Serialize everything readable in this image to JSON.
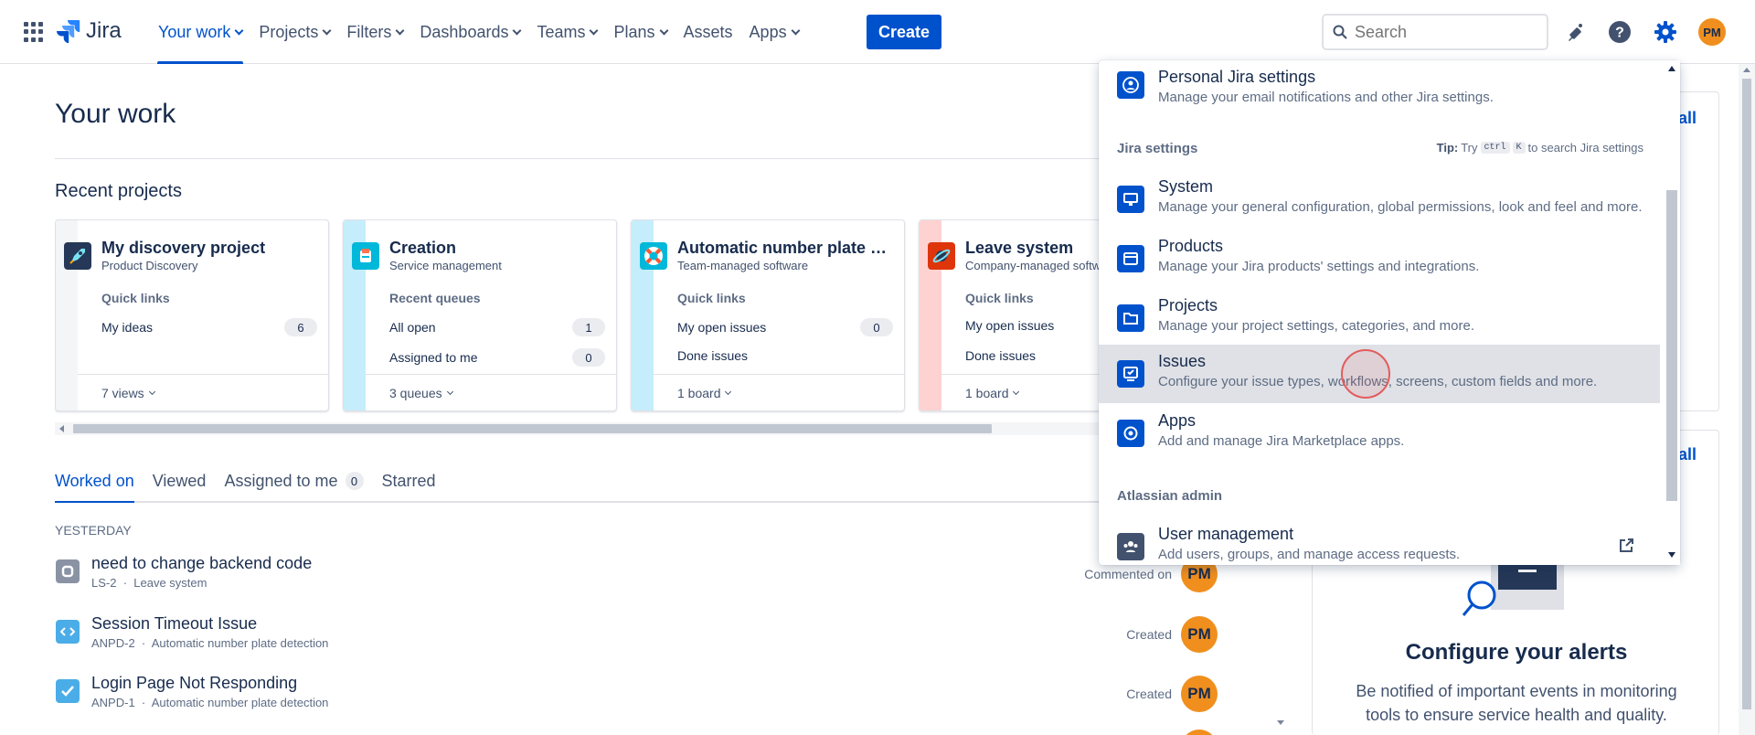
{
  "topnav": {
    "logo": "Jira",
    "items": [
      {
        "label": "Your work",
        "dropdown": true,
        "active": true
      },
      {
        "label": "Projects",
        "dropdown": true
      },
      {
        "label": "Filters",
        "dropdown": true
      },
      {
        "label": "Dashboards",
        "dropdown": true
      },
      {
        "label": "Teams",
        "dropdown": true
      },
      {
        "label": "Plans",
        "dropdown": true
      },
      {
        "label": "Assets",
        "dropdown": false
      },
      {
        "label": "Apps",
        "dropdown": true
      }
    ],
    "create_label": "Create",
    "search_placeholder": "Search",
    "avatar_initials": "PM",
    "icons": [
      "app-switcher-icon",
      "jira-logo-icon",
      "search-icon",
      "notifications-icon",
      "help-icon",
      "settings-icon"
    ]
  },
  "main": {
    "title": "Your work",
    "recent_projects_title": "Recent projects",
    "projects": [
      {
        "name": "My discovery project",
        "type": "Product Discovery",
        "color": "#f4f5f7",
        "icon_bg": "#253858",
        "links_label": "Quick links",
        "links": [
          {
            "label": "My ideas",
            "count": "6"
          }
        ],
        "footer": "7 views"
      },
      {
        "name": "Creation",
        "type": "Service management",
        "color": "#c6edfb",
        "icon_bg": "#00b8d9",
        "links_label": "Recent queues",
        "links": [
          {
            "label": "All open",
            "count": "1"
          },
          {
            "label": "Assigned to me",
            "count": "0"
          }
        ],
        "footer": "3 queues"
      },
      {
        "name": "Automatic number plate detection",
        "type": "Team-managed software",
        "color": "#c6edfb",
        "icon_bg": "#00b8d9",
        "links_label": "Quick links",
        "links": [
          {
            "label": "My open issues",
            "count": "0"
          },
          {
            "label": "Done issues",
            "count": ""
          }
        ],
        "footer": "1 board"
      },
      {
        "name": "Leave system",
        "type": "Company-managed software",
        "color": "#ffd2d2",
        "icon_bg": "#de350b",
        "links_label": "Quick links",
        "links": [
          {
            "label": "My open issues",
            "count": ""
          },
          {
            "label": "Done issues",
            "count": ""
          }
        ],
        "footer": "1 board"
      }
    ],
    "tabs": [
      {
        "label": "Worked on",
        "active": true
      },
      {
        "label": "Viewed"
      },
      {
        "label": "Assigned to me",
        "count": "0"
      },
      {
        "label": "Starred"
      }
    ],
    "group_label": "YESTERDAY",
    "work_items": [
      {
        "title": "need to change backend code",
        "key": "LS-2",
        "project": "Leave system",
        "action": "Commented on",
        "avatar": "PM",
        "icon": "subtask-icon"
      },
      {
        "title": "Session Timeout Issue",
        "key": "ANPD-2",
        "project": "Automatic number plate detection",
        "action": "Created",
        "avatar": "PM",
        "icon": "code-icon"
      },
      {
        "title": "Login Page Not Responding",
        "key": "ANPD-1",
        "project": "Automatic number plate detection",
        "action": "Created",
        "avatar": "PM",
        "icon": "task-icon"
      }
    ]
  },
  "right": {
    "panel1_link": "all",
    "panel2_link": "all",
    "alerts_title": "Configure your alerts",
    "alerts_desc": "Be notified of important events in monitoring tools to ensure service health and quality."
  },
  "settings_menu": {
    "personal": {
      "title": "Personal Jira settings",
      "desc": "Manage your email notifications and other Jira settings."
    },
    "jira_section": "Jira settings",
    "tip_label": "Tip:",
    "tip_text": "Try",
    "tip_key1": "ctrl",
    "tip_key2": "K",
    "tip_suffix": "to search Jira settings",
    "items": [
      {
        "title": "System",
        "desc": "Manage your general configuration, global permissions, look and feel and more."
      },
      {
        "title": "Products",
        "desc": "Manage your Jira products' settings and integrations."
      },
      {
        "title": "Projects",
        "desc": "Manage your project settings, categories, and more."
      },
      {
        "title": "Issues",
        "desc": "Configure your issue types, workflows, screens, custom fields and more.",
        "hover": true
      },
      {
        "title": "Apps",
        "desc": "Add and manage Jira Marketplace apps."
      }
    ],
    "admin_section": "Atlassian admin",
    "user_mgmt": {
      "title": "User management",
      "desc": "Add users, groups, and manage access requests."
    }
  },
  "colors": {
    "brand": "#0052cc",
    "text": "#172b4d",
    "subtle": "#5e6c84",
    "avatar": "#f08f1e"
  }
}
